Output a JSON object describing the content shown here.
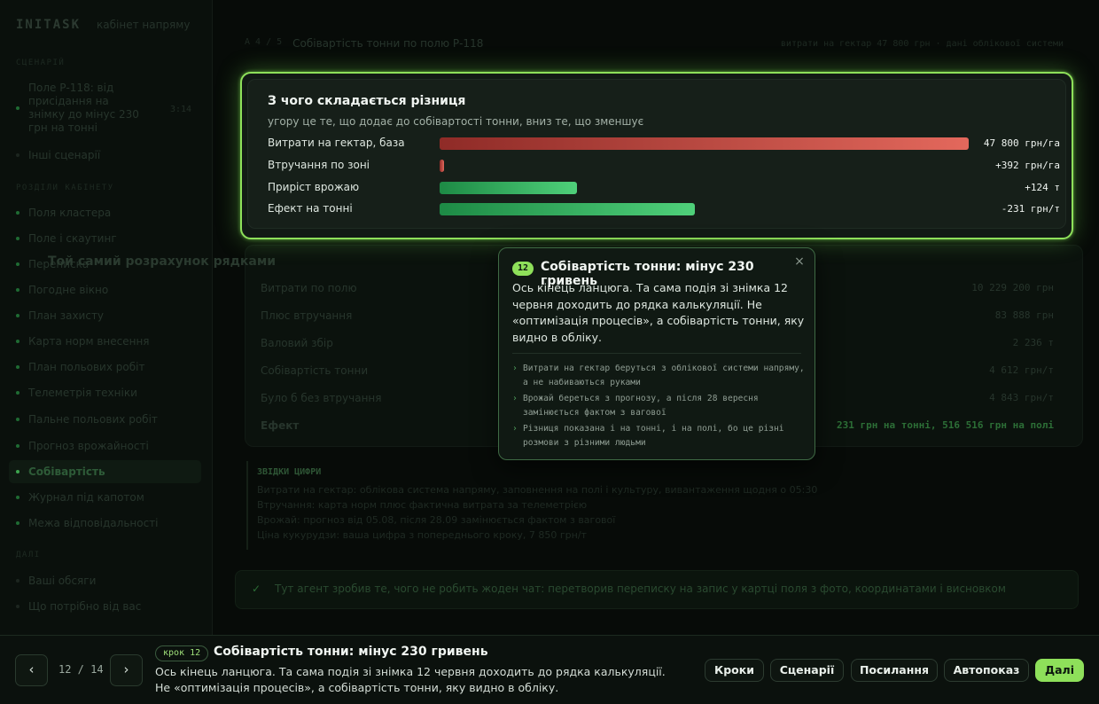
{
  "sidebar": {
    "brand": "INITASK",
    "brand_subtitle": "кабінет напряму",
    "section_scenario": "СЦЕНАРІЙ",
    "scenario": {
      "label": "Поле Р-118: від присідання на знімку до мінус 230 грн на тонні",
      "time": "3:14"
    },
    "other_scenarios": "Інші сценарії",
    "section_sections": "РОЗДІЛИ КАБІНЕТУ",
    "items": [
      "Поля кластера",
      "Поле і скаутинг",
      "Переписка",
      "Погодне вікно",
      "План захисту",
      "Карта норм внесення",
      "План польових робіт",
      "Телеметрія техніки",
      "Пальне польових робіт",
      "Прогноз врожайності",
      "Собівартість",
      "Журнал під капотом",
      "Межа відповідальності"
    ],
    "section_next": "ДАЛІ",
    "next_items": [
      "Ваші обсяги",
      "Що потрібно від вас"
    ]
  },
  "main": {
    "crumb_prefix": "A 4 / 5",
    "crumb_title": "Собівартість тонни по полю Р-118",
    "crumb_right": "витрати на гектар 47 800 грн · дані облікової системи",
    "focus_card": {
      "title": "З чого складається різниця",
      "subtitle": "угору це те, що додає до собівартості тонни, вниз те, що зменшує",
      "rows": [
        {
          "label": "Витрати на гектар, база",
          "value": "47 800 грн/га",
          "fraction": 1.0,
          "kind": "red"
        },
        {
          "label": "Втручання по зоні",
          "value": "+392 грн/га",
          "fraction": 0.008,
          "kind": "red"
        },
        {
          "label": "Приріст врожаю",
          "value": "+124 т",
          "fraction": 0.26,
          "kind": "green"
        },
        {
          "label": "Ефект на тонні",
          "value": "-231 грн/т",
          "fraction": 0.483,
          "kind": "green"
        }
      ]
    },
    "ledger": {
      "title": "Той самий розрахунок рядками",
      "rows": [
        {
          "label": "Витрати по полю",
          "value": "10 229 200 грн"
        },
        {
          "label": "Плюс втручання",
          "value": "83 888 грн"
        },
        {
          "label": "Валовий збір",
          "value": "2 236 т"
        },
        {
          "label": "Собівартість тонни",
          "value": "4 612 грн/т"
        },
        {
          "label": "Було б без втручання",
          "value": "4 843 грн/т"
        },
        {
          "label": "Ефект",
          "value": "231 грн на тонні, 516 516 грн на полі"
        }
      ]
    },
    "sources": {
      "title": "ЗВІДКИ ЦИФРИ",
      "lines": [
        "Витрати на гектар: облікова система напряму, заповнення на полі і культуру, вивантаження щодня о 05:30",
        "Втручання: карта норм плюс фактична витрата за телеметрією",
        "Врожай: прогноз від 05.08, після 28.09 замінюється фактом з вагової",
        "Ціна кукурудзи: ваша цифра з попереднього кроку, 7 850 грн/т"
      ]
    },
    "agent_note": "Тут агент зробив те, чого не робить жоден чат: перетворив переписку на запис у картці поля з фото, координатами і висновком"
  },
  "popover": {
    "badge": "12",
    "title": "Собівартість тонни: мінус 230 гривень",
    "close": "×",
    "body": "Ось кінець ланцюга. Та сама подія зі знімка 12 червня доходить до рядка калькуляції. Не «оптимізація процесів», а собівартість тонни, яку видно в обліку.",
    "notes": [
      "Витрати на гектар беруться з облікової системи напряму, а не набиваються руками",
      "Врожай береться з прогнозу, а після 28 вересня замінюється фактом з вагової",
      "Різниця показана і на тонні, і на полі, бо це різні розмови з різними людьми"
    ]
  },
  "bottombar": {
    "prev": "‹",
    "next": "›",
    "counter": "12 / 14",
    "step_pill": "крок 12",
    "title": "Собівартість тонни: мінус 230 гривень",
    "description": "Ось кінець ланцюга. Та сама подія зі знімка 12 червня доходить до рядка калькуляції. Не «оптимізація процесів», а собівартість тонни, яку видно в обліку.",
    "buttons": {
      "steps": "Кроки",
      "scenarios": "Сценарії",
      "links": "Посилання",
      "autoplay": "Автопоказ",
      "next": "Далі"
    }
  }
}
